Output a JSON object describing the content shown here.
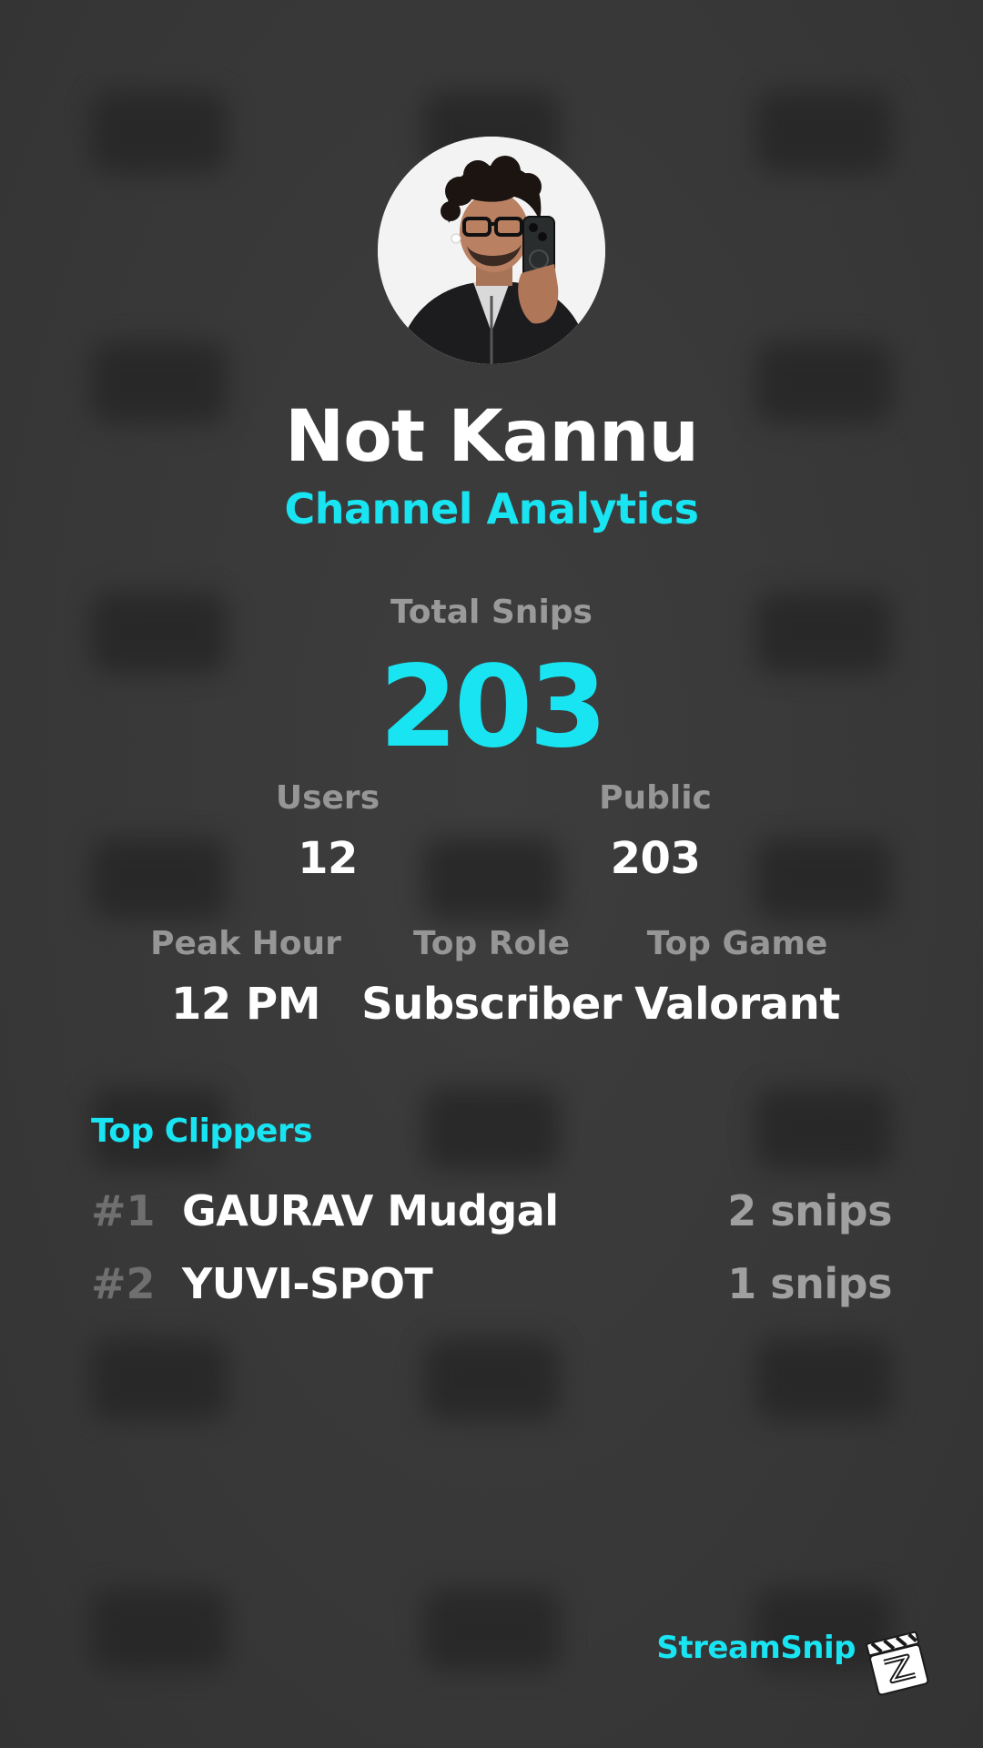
{
  "profile": {
    "name": "Not Kannu",
    "subtitle": "Channel Analytics"
  },
  "totals": {
    "label": "Total Snips",
    "value": "203"
  },
  "stats_row1": [
    {
      "label": "Users",
      "value": "12"
    },
    {
      "label": "Public",
      "value": "203"
    }
  ],
  "stats_row2": [
    {
      "label": "Peak Hour",
      "value": "12 PM"
    },
    {
      "label": "Top Role",
      "value": "Subscriber"
    },
    {
      "label": "Top Game",
      "value": "Valorant"
    }
  ],
  "top_clippers": {
    "title": "Top Clippers",
    "items": [
      {
        "rank": "#1",
        "name": "GAURAV Mudgal",
        "count": "2 snips"
      },
      {
        "rank": "#2",
        "name": "YUVI-SPOT",
        "count": "1 snips"
      }
    ]
  },
  "brand": {
    "name": "StreamSnip",
    "logo_icon": "clapperboard-icon"
  },
  "colors": {
    "accent": "#19e4f2",
    "background": "#3a3a3a",
    "label": "#969696",
    "value": "#ffffff"
  }
}
